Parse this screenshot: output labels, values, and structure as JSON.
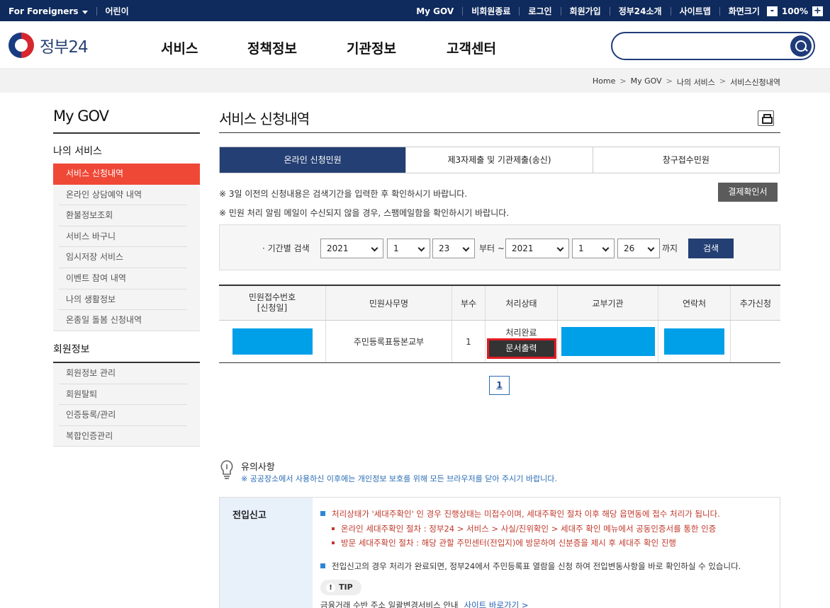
{
  "topbar": {
    "foreigners": "For Foreigners",
    "kids": "어린이",
    "links": [
      "My GOV",
      "비회원종료",
      "로그인",
      "회원가입",
      "정부24소개",
      "사이트맵"
    ],
    "zoom_label": "화면크기",
    "zoom_minus": "-",
    "zoom_value": "100%",
    "zoom_plus": "+"
  },
  "header": {
    "logo": "정부24",
    "nav": [
      "서비스",
      "정책정보",
      "기관정보",
      "고객센터"
    ],
    "search_placeholder": ""
  },
  "breadcrumb": [
    "Home",
    "My GOV",
    "나의 서비스",
    "서비스신청내역"
  ],
  "sidebar": {
    "title": "My GOV",
    "sections": [
      {
        "title": "나의 서비스",
        "items": [
          "서비스 신청내역",
          "온라인 상담예약 내역",
          "환불정보조회",
          "서비스 바구니",
          "임시저장 서비스",
          "이벤트 참여 내역",
          "나의 생활정보",
          "온종일 돌봄 신청내역"
        ]
      },
      {
        "title": "회원정보",
        "items": [
          "회원정보 관리",
          "회원탈퇴",
          "인증등록/관리",
          "복합인증관리"
        ]
      }
    ]
  },
  "main": {
    "title": "서비스 신청내역",
    "tabs": [
      "온라인 신청민원",
      "제3자제출 및 기관제출(송신)",
      "창구접수민원"
    ],
    "notes": [
      "※ 3일 이전의 신청내용은 검색기간을 입력한 후 확인하시기 바랍니다.",
      "※ 민원 처리 알림 메일이 수신되지 않을 경우, 스팸메일함을 확인하시기 바랍니다."
    ],
    "receipt_button": "결제확인서",
    "period": {
      "label": "· 기간별 검색",
      "from_year": "2021",
      "from_month": "1",
      "from_day": "23",
      "from_text": "부터 ~",
      "to_year": "2021",
      "to_month": "1",
      "to_day": "26",
      "to_text": "까지",
      "search_button": "검색"
    },
    "table": {
      "headers": [
        "민원접수번호\n[신청일]",
        "민원사무명",
        "부수",
        "처리상태",
        "교부기관",
        "연락처",
        "추가신청"
      ],
      "rows": [
        {
          "service": "주민등록표등본교부",
          "copies": "1",
          "status": "처리완료",
          "print_button": "문서출력"
        }
      ]
    },
    "page": "1"
  },
  "caution": {
    "title": "유의사항",
    "text": "※ 공공장소에서 사용하신 이후에는 개인정보 보호를 위해 모든 브라우저를 닫아 주시기 바랍니다."
  },
  "notice": {
    "label": "전입신고",
    "line1": "처리상태가 '세대주확인' 인 경우 진행상태는 미접수이며, 세대주확인 절차 이후 해당 읍면동에 접수 처리가 됩니다.",
    "line2": "온라인 세대주확인 절차 : 정부24 > 서비스 > 사실/진위확인 > 세대주 확인 메뉴에서 공동인증서를 통한 인증",
    "line3": "방문 세대주확인 절차 : 해당 관할 주민센터(전입지)에 방문하여 신분증을 제시 후 세대주 확인 진행",
    "line4": "전입신고의 경우 처리가 완료되면, 정부24에서 주민등록표 열람을 신청 하여 전입변동사항을 바로 확인하실 수 있습니다.",
    "tip": "TIP",
    "tip_text": "금융거래 수반 주소 일괄변경서비스 안내",
    "tip_link": "사이트 바로가기 >"
  }
}
